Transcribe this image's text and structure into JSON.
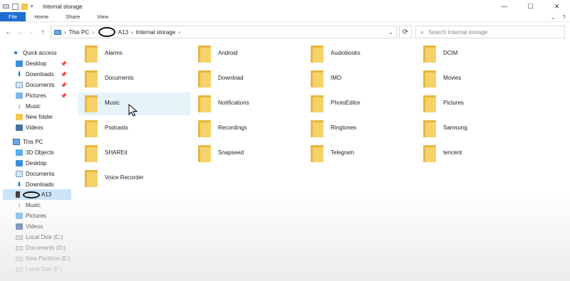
{
  "window": {
    "title": "Internal storage",
    "controls": {
      "minimize": "—",
      "maximize": "☐",
      "close": "✕"
    }
  },
  "ribbon": {
    "tabs": [
      "File",
      "Home",
      "Share",
      "View"
    ],
    "right": {
      "expand": "⌄",
      "help": "?"
    }
  },
  "address": {
    "crumbs": [
      "This PC",
      "A13",
      "Internal storage"
    ],
    "sep": "›"
  },
  "search": {
    "placeholder": "Search Internal storage"
  },
  "sidebar": {
    "items": [
      {
        "label": "Quick access",
        "icon": "star-icon"
      },
      {
        "label": "Desktop",
        "icon": "desktop-icon",
        "pinned": true
      },
      {
        "label": "Downloads",
        "icon": "downloads-icon",
        "pinned": true
      },
      {
        "label": "Documents",
        "icon": "documents-icon",
        "pinned": true
      },
      {
        "label": "Pictures",
        "icon": "pictures-icon",
        "pinned": true
      },
      {
        "label": "Music",
        "icon": "music-icon"
      },
      {
        "label": "New folder",
        "icon": "folder-icon"
      },
      {
        "label": "Videos",
        "icon": "videos-icon"
      },
      {
        "label": "This PC",
        "icon": "pc-icon"
      },
      {
        "label": "3D Objects",
        "icon": "3d-objects-icon"
      },
      {
        "label": "Desktop",
        "icon": "desktop-icon"
      },
      {
        "label": "Documents",
        "icon": "documents-icon"
      },
      {
        "label": "Downloads",
        "icon": "downloads-icon"
      },
      {
        "label": "A13",
        "icon": "phone-icon",
        "selected": true
      },
      {
        "label": "Music",
        "icon": "music-icon"
      },
      {
        "label": "Pictures",
        "icon": "pictures-icon"
      },
      {
        "label": "Videos",
        "icon": "videos-icon"
      },
      {
        "label": "Local Disk (C:)",
        "icon": "drive-icon"
      },
      {
        "label": "Documents (D:)",
        "icon": "drive-icon"
      },
      {
        "label": "New Partition (E:)",
        "icon": "drive-icon"
      },
      {
        "label": "Local Disk (F:)",
        "icon": "drive-icon"
      }
    ]
  },
  "folders": [
    "Alarms",
    "Android",
    "Audiobooks",
    "DCIM",
    "Documents",
    "Download",
    "IMO",
    "Movies",
    "Music",
    "Notifications",
    "PhotoEditor",
    "Pictures",
    "Podcasts",
    "Recordings",
    "Ringtones",
    "Samsung",
    "SHAREit",
    "Snapseed",
    "Telegram",
    "tencent",
    "Voice Recorder"
  ],
  "colors": {
    "accent": "#1e6ed2",
    "selected": "#cce4f7",
    "hover": "#e5f3fb",
    "folder": "#f6d26b"
  }
}
